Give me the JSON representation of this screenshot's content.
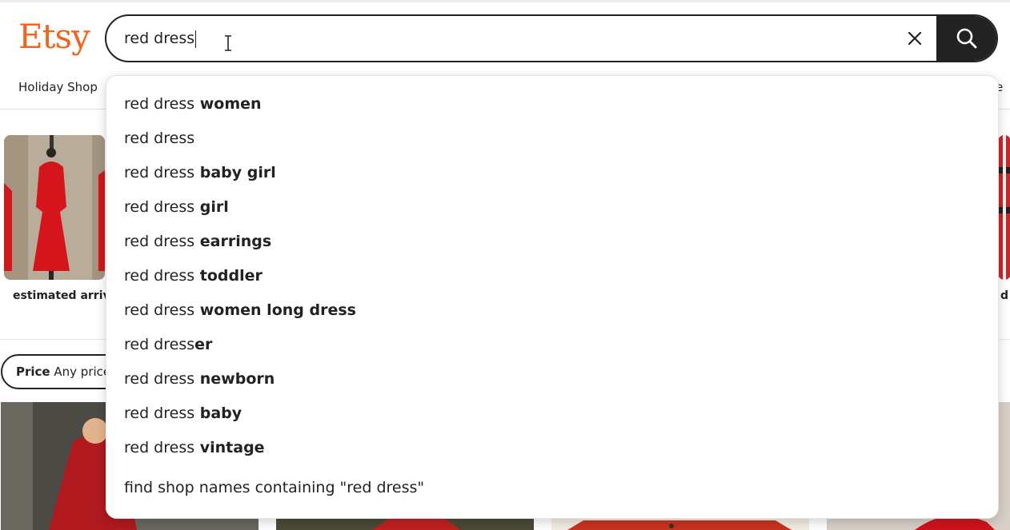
{
  "brand": {
    "logo_text": "Etsy",
    "color": "#f1641e"
  },
  "search": {
    "value": "red dress",
    "clear_icon": "close-icon",
    "submit_icon": "search-icon"
  },
  "nav": {
    "left_label": "Holiday Shop",
    "right_label": "le"
  },
  "categories": {
    "left_caption": "estimated arriv",
    "right_caption": "d"
  },
  "filters": {
    "price_label": "Price",
    "price_value": "Any price"
  },
  "suggestions": [
    {
      "prefix": "red dress",
      "suffix": " women"
    },
    {
      "prefix": "red dress",
      "suffix": ""
    },
    {
      "prefix": "red dress",
      "suffix": " baby girl"
    },
    {
      "prefix": "red dress",
      "suffix": " girl"
    },
    {
      "prefix": "red dress",
      "suffix": " earrings"
    },
    {
      "prefix": "red dress",
      "suffix": " toddler"
    },
    {
      "prefix": "red dress",
      "suffix": " women long dress"
    },
    {
      "prefix": "red dress",
      "suffix": "er"
    },
    {
      "prefix": "red dress",
      "suffix": " newborn"
    },
    {
      "prefix": "red dress",
      "suffix": " baby"
    },
    {
      "prefix": "red dress",
      "suffix": " vintage"
    }
  ],
  "shop_search": {
    "label": "find shop names containing \"red dress\""
  }
}
